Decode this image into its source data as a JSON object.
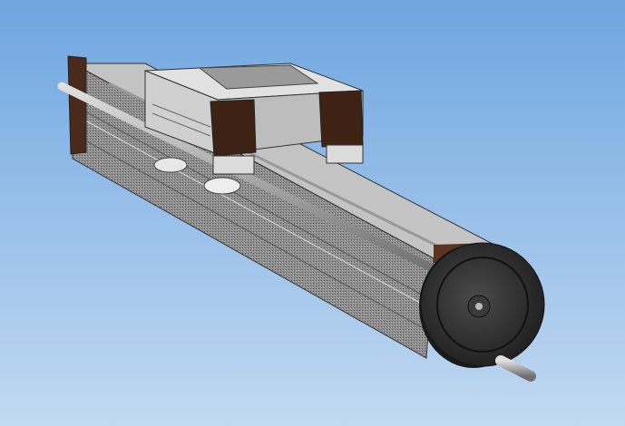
{
  "viewport": {
    "background_top": "#6ea6e0",
    "background_bottom": "#c2d9f2",
    "model": "linear-slide-with-handwheel"
  },
  "colors": {
    "rail_top": "#b9b9b9",
    "rail_side": "#8a8a8a",
    "end_cap": "#4a2a1a",
    "carriage": "#d4d4d4",
    "handwheel": "#2b2b2b"
  }
}
